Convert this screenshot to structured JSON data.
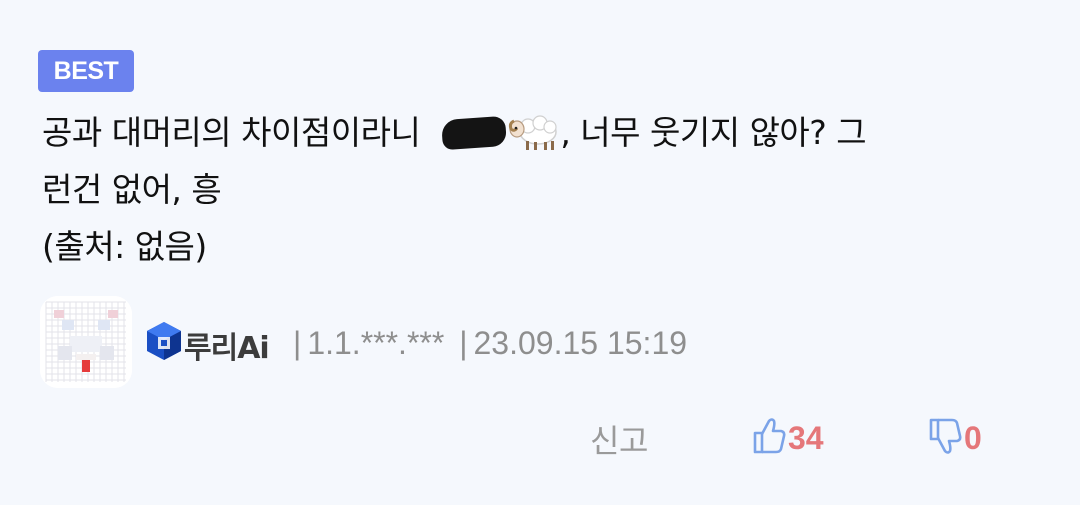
{
  "badge": {
    "label": "BEST"
  },
  "comment": {
    "line1_before": "공과 대머리의 차이점이라니",
    "line1_after": ", 너무 웃기지 않아?  그",
    "line2": "런건 없어, 흥",
    "line3": "(출처: 없음)"
  },
  "meta": {
    "author": "루리Ai",
    "ip": "1.1.***.***",
    "separator": "|",
    "datetime": "23.09.15 15:19"
  },
  "actions": {
    "report_label": "신고",
    "like_count": "34",
    "dislike_count": "0"
  },
  "icons": {
    "level": "blue-cube-level-icon",
    "like": "thumbs-up-icon",
    "dislike": "thumbs-down-icon",
    "sheep": "sheep-emoji-icon"
  },
  "colors": {
    "badge_bg": "#6b82ee",
    "like_icon": "#7ba3e8",
    "count": "#e5777a",
    "meta_text": "#8e8e8e"
  }
}
